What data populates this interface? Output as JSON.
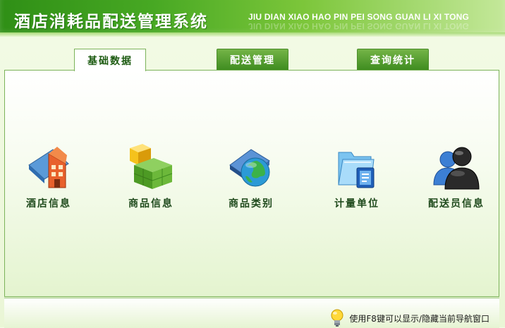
{
  "header": {
    "title": "酒店消耗品配送管理系统",
    "subtitle": "JIU DIAN XIAO HAO PIN PEI SONG GUAN LI XI TONG"
  },
  "tabs": [
    {
      "label": "基础数据",
      "active": true
    },
    {
      "label": "配送管理",
      "active": false
    },
    {
      "label": "查询统计",
      "active": false
    }
  ],
  "modules": [
    {
      "label": "酒店信息",
      "icon": "hotel-icon"
    },
    {
      "label": "商品信息",
      "icon": "product-blocks-icon"
    },
    {
      "label": "商品类别",
      "icon": "globe-book-icon"
    },
    {
      "label": "计量单位",
      "icon": "folder-icon"
    },
    {
      "label": "配送员信息",
      "icon": "users-icon"
    }
  ],
  "status": {
    "hint": "使用F8键可以显示/隐藏当前导航窗口",
    "icon": "lightbulb-icon"
  },
  "colors": {
    "brand_green": "#3f8c20",
    "panel_border": "#7cb35a",
    "label_text": "#1f4a1c"
  }
}
